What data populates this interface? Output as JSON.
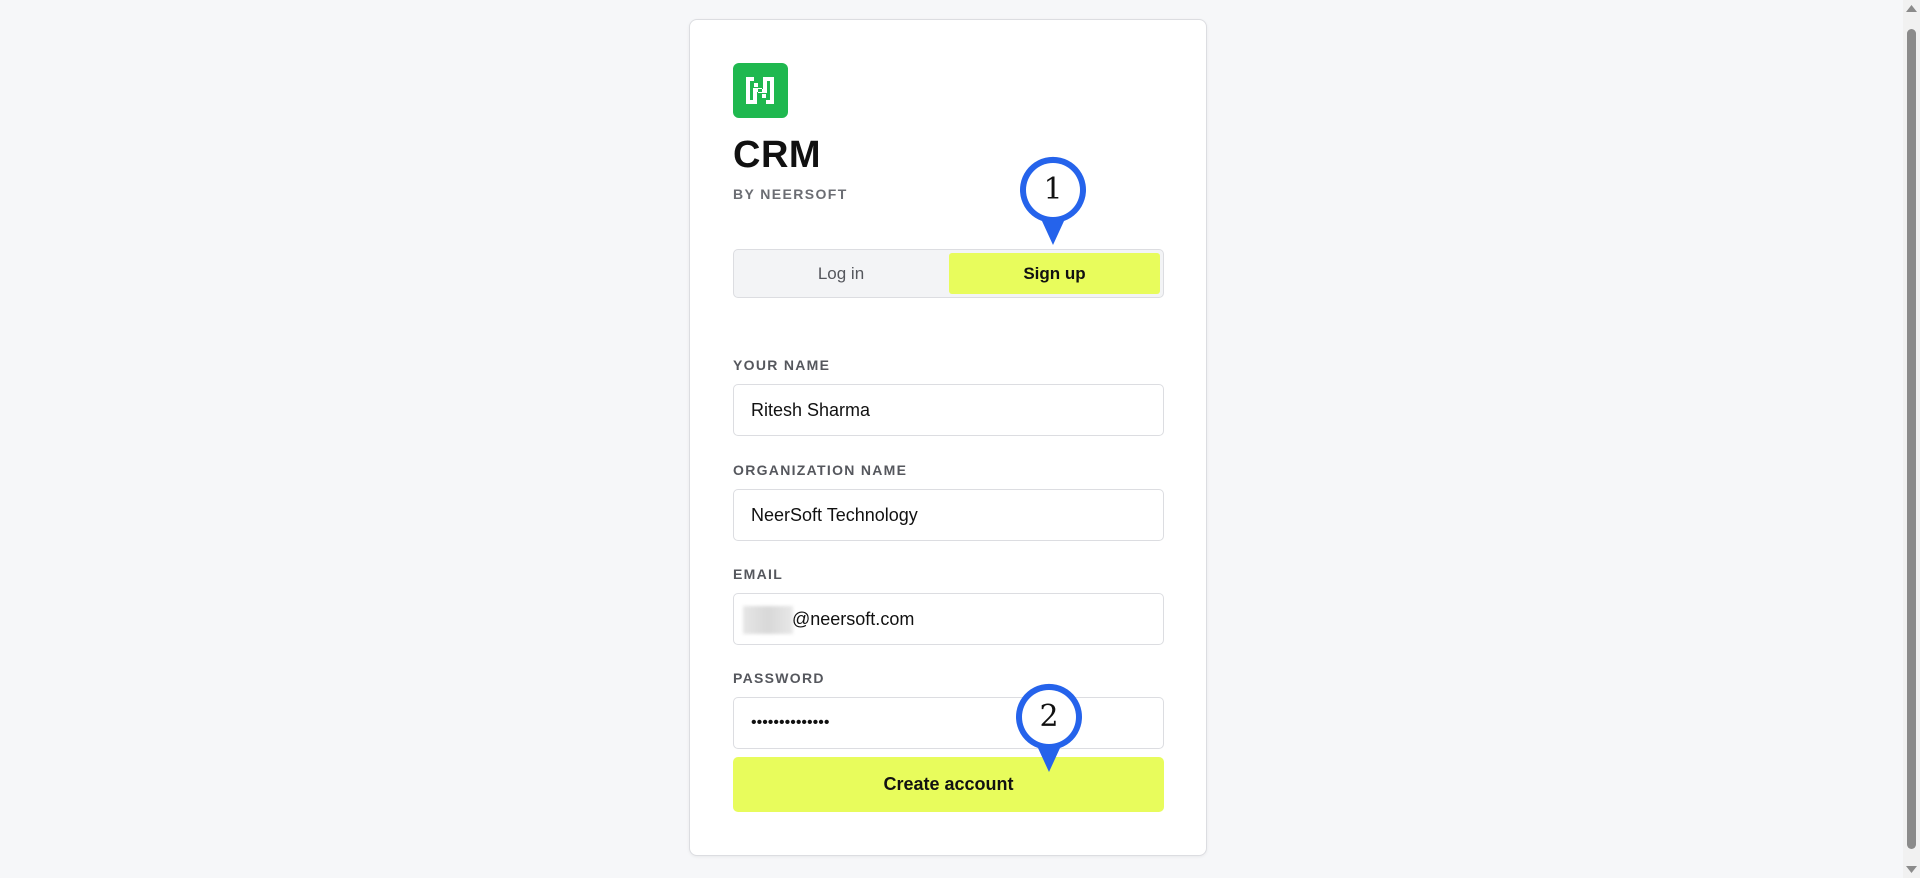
{
  "brand": {
    "title": "CRM",
    "subtitle": "BY NEERSOFT",
    "logo_icon": "neersoft-logo-icon",
    "logo_color": "#1fb84f"
  },
  "tabs": {
    "login_label": "Log in",
    "signup_label": "Sign up",
    "active": "Sign up"
  },
  "form": {
    "name_label": "YOUR NAME",
    "name_value": "Ritesh Sharma",
    "org_label": "ORGANIZATION NAME",
    "org_value": "NeerSoft Technology",
    "email_label": "EMAIL",
    "email_value": "@neersoft.com",
    "password_label": "PASSWORD",
    "password_value": "••••••••••••••",
    "submit_label": "Create account"
  },
  "markers": {
    "first": "1",
    "second": "2"
  },
  "colors": {
    "accent": "#e8fc5c",
    "marker": "#2563eb",
    "background": "#f6f7f9"
  }
}
